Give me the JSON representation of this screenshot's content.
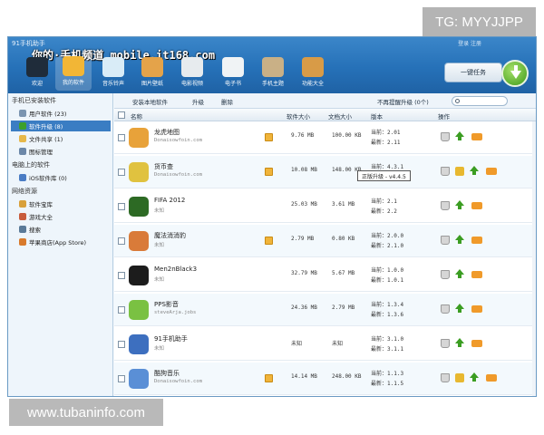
{
  "watermarks": {
    "top_right": "TG: MYYJJPP",
    "bottom_left": "www.tubaninfo.com"
  },
  "app": {
    "title": "91手机助手",
    "overlay": "你的·手机频道 mobile.it168.com",
    "window_controls": "登录 注册"
  },
  "toolbar": [
    {
      "label": "欢迎",
      "icon": "phone-icon",
      "color": "#1f2c3a"
    },
    {
      "label": "我的软件",
      "icon": "apps-icon",
      "color": "#f2b636",
      "active": true
    },
    {
      "label": "音乐铃声",
      "icon": "music-disc-icon",
      "color": "#d9ecf7"
    },
    {
      "label": "图片壁纸",
      "icon": "picture-icon",
      "color": "#e4a34a"
    },
    {
      "label": "电影视频",
      "icon": "film-reel-icon",
      "color": "#e7ebee"
    },
    {
      "label": "电子书",
      "icon": "book-icon",
      "color": "#f0f3f5"
    },
    {
      "label": "手机主题",
      "icon": "theme-icon",
      "color": "#c9b086"
    },
    {
      "label": "功能大全",
      "icon": "toolbox-icon",
      "color": "#d89b47"
    }
  ],
  "one_click": {
    "label": "一键任务"
  },
  "sidebar": {
    "sections": [
      {
        "title": "手机已安装软件",
        "items": [
          {
            "label": "用户软件 (23)",
            "icon": "user-apps-icon"
          },
          {
            "label": "软件升级 (8)",
            "icon": "upgrade-icon",
            "active": true
          },
          {
            "label": "文件共享 (1)",
            "icon": "folder-icon"
          },
          {
            "label": "图标管理",
            "icon": "icon-manager-icon"
          }
        ]
      },
      {
        "title": "电脑上的软件",
        "items": [
          {
            "label": "iOS软件库 (0)",
            "icon": "library-icon"
          }
        ]
      },
      {
        "title": "网络资源",
        "items": [
          {
            "label": "软件宝库",
            "icon": "store-icon"
          },
          {
            "label": "游戏大全",
            "icon": "game-icon"
          },
          {
            "label": "搜索",
            "icon": "search-icon"
          },
          {
            "label": "苹果商店(App Store)",
            "icon": "app-store-icon"
          }
        ]
      }
    ]
  },
  "subbar": {
    "install_local": "安装本地软件",
    "upgrade": "升级",
    "delete": "删除",
    "ignore": "不再提醒升级 (0个)"
  },
  "table": {
    "columns": {
      "name": "名称",
      "software_size": "软件大小",
      "document_size": "文档大小",
      "version": "版本",
      "actions": "操作"
    },
    "version_current_prefix": "当前：",
    "version_latest_prefix": "最新：",
    "rows": [
      {
        "name": "龙虎地图",
        "author": "Donaisowfoin.com",
        "size": "9.76 MB",
        "doc_size": "100.00 KB",
        "current": "2.01",
        "latest": "2.11",
        "icon_color": "#e8a23a",
        "note": true
      },
      {
        "name": "货币查",
        "author": "Donaisowfoin.com",
        "size": "10.08 MB",
        "doc_size": "148.00 KB",
        "current": "4.3.1",
        "latest": "4.4.5",
        "icon_color": "#e0c23f",
        "note": true,
        "star": true
      },
      {
        "name": "FIFA 2012",
        "author": "未知",
        "size": "25.03 MB",
        "doc_size": "3.61 MB",
        "current": "2.1",
        "latest": "2.2",
        "icon_color": "#2d6a24"
      },
      {
        "name": "魔法消消豹",
        "author": "未知",
        "size": "2.79 MB",
        "doc_size": "0.80 KB",
        "current": "2.0.0",
        "latest": "2.1.0",
        "icon_color": "#d97b39",
        "note": true
      },
      {
        "name": "Men2nBlack3",
        "author": "未知",
        "size": "32.79 MB",
        "doc_size": "5.67 MB",
        "current": "1.0.0",
        "latest": "1.0.1",
        "icon_color": "#1c1c1c"
      },
      {
        "name": "PPS影音",
        "author": "steveArja.jobs",
        "size": "24.36 MB",
        "doc_size": "2.79 MB",
        "current": "1.3.4",
        "latest": "1.3.6",
        "icon_color": "#7ac142"
      },
      {
        "name": "91手机助手",
        "author": "未知",
        "size": "未知",
        "doc_size": "未知",
        "current": "3.1.0",
        "latest": "3.1.1",
        "icon_color": "#3d6fbf"
      },
      {
        "name": "酷狗音乐",
        "author": "Donaisowfoin.com",
        "size": "14.14 MB",
        "doc_size": "248.00 KB",
        "current": "1.1.3",
        "latest": "1.1.5",
        "icon_color": "#5a8fd6",
        "note": true,
        "star": true
      }
    ]
  },
  "tooltip": "正版升级 - v4.4.5"
}
